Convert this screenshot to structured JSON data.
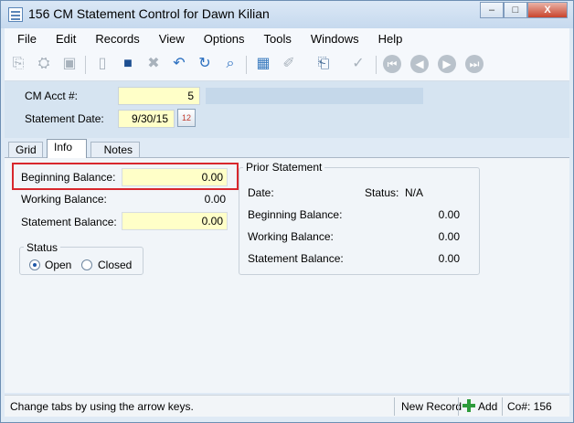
{
  "window": {
    "title": "156 CM Statement Control for Dawn Kilian",
    "min_label": "–",
    "max_label": "□",
    "close_label": "X"
  },
  "menu": [
    "File",
    "Edit",
    "Records",
    "View",
    "Options",
    "Tools",
    "Windows",
    "Help"
  ],
  "toolbar": [
    {
      "name": "open-icon",
      "glyph": "⎘"
    },
    {
      "name": "binoculars-icon",
      "glyph": "⛭"
    },
    {
      "name": "briefcase-icon",
      "glyph": "▣"
    },
    {
      "name": "new-document-icon",
      "glyph": "▯"
    },
    {
      "name": "save-icon",
      "glyph": "■"
    },
    {
      "name": "delete-icon",
      "glyph": "✖"
    },
    {
      "name": "undo-icon",
      "glyph": "↶"
    },
    {
      "name": "refresh-icon",
      "glyph": "↻"
    },
    {
      "name": "search-icon",
      "glyph": "⌕"
    },
    {
      "name": "calculator-icon",
      "glyph": "▦"
    },
    {
      "name": "attachment-icon",
      "glyph": "✐"
    },
    {
      "name": "scanner-icon",
      "glyph": "⎗"
    },
    {
      "name": "spellcheck-icon",
      "glyph": "✓"
    },
    {
      "name": "first-record-icon",
      "glyph": "⏮"
    },
    {
      "name": "previous-record-icon",
      "glyph": "◀"
    },
    {
      "name": "next-record-icon",
      "glyph": "▶"
    },
    {
      "name": "last-record-icon",
      "glyph": "⏭"
    }
  ],
  "header": {
    "acct_label": "CM Acct #:",
    "acct_value": "5",
    "date_label": "Statement Date:",
    "date_value": "9/30/15",
    "calendar_label": "12"
  },
  "tabs": [
    "Grid",
    "Info",
    "Notes"
  ],
  "info": {
    "beginning_label": "Beginning Balance:",
    "beginning_value": "0.00",
    "working_label": "Working Balance:",
    "working_value": "0.00",
    "statement_label": "Statement Balance:",
    "statement_value": "0.00"
  },
  "status_group": {
    "title": "Status",
    "open_label": "Open",
    "closed_label": "Closed",
    "selected": "Open"
  },
  "prior": {
    "title": "Prior Statement",
    "date_label": "Date:",
    "status_label": "Status:",
    "status_value": "N/A",
    "beginning_label": "Beginning Balance:",
    "beginning_value": "0.00",
    "working_label": "Working Balance:",
    "working_value": "0.00",
    "statement_label": "Statement Balance:",
    "statement_value": "0.00"
  },
  "statusbar": {
    "hint": "Change tabs by using the arrow keys.",
    "mode": "New Record",
    "add_label": "Add",
    "co_label": "Co#: 156"
  },
  "colors": {
    "highlight": "#d8272d",
    "field_yellow": "#ffffc8",
    "header_blue": "#d6e4f1"
  }
}
